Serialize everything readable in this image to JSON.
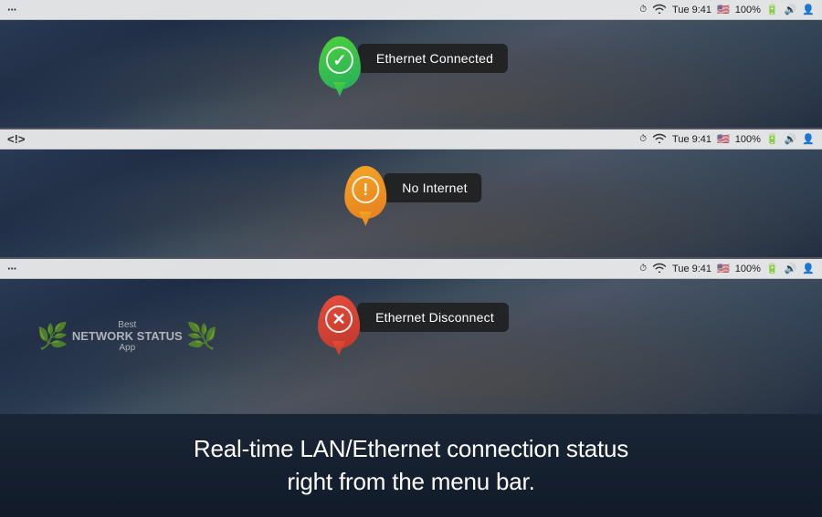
{
  "panels": [
    {
      "id": "panel-connected",
      "menubar": {
        "left_icon": "···",
        "left_icon_type": "dots",
        "speedometer": "⏱",
        "wifi": "WiFi",
        "time": "Tue 9:41",
        "battery": "100%",
        "volume": "♪",
        "user": "👤"
      },
      "status": {
        "color": "green",
        "icon": "check",
        "label": "Ethernet Connected"
      }
    },
    {
      "id": "panel-no-internet",
      "menubar": {
        "left_icon": "<!>",
        "left_icon_type": "exclaim",
        "speedometer": "⏱",
        "wifi": "WiFi",
        "time": "Tue 9:41",
        "battery": "100%",
        "volume": "♪",
        "user": "👤"
      },
      "status": {
        "color": "orange",
        "icon": "exclaim",
        "label": "No Internet"
      }
    },
    {
      "id": "panel-disconnect",
      "menubar": {
        "left_icon": "···",
        "left_icon_type": "dots",
        "speedometer": "⏱",
        "wifi": "WiFi",
        "time": "Tue 9:41",
        "battery": "100%",
        "volume": "♪",
        "user": "👤"
      },
      "status": {
        "color": "red",
        "icon": "cross",
        "label": "Ethernet Disconnect"
      },
      "award": {
        "best": "Best",
        "title": "NETWORK STATUS",
        "app": "App"
      }
    }
  ],
  "bottom_text_line1": "Real-time LAN/Ethernet connection status",
  "bottom_text_line2": "right from the menu bar."
}
